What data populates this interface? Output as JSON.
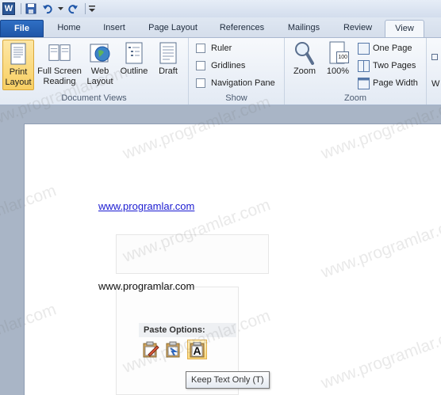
{
  "quick_access": {
    "icons": [
      "word-logo",
      "save-icon",
      "undo-icon",
      "redo-icon",
      "customize-icon"
    ],
    "word_logo_letter": "W"
  },
  "tabs": [
    "File",
    "Home",
    "Insert",
    "Page Layout",
    "References",
    "Mailings",
    "Review",
    "View"
  ],
  "active_tab": "View",
  "ribbon": {
    "document_views": {
      "label": "Document Views",
      "buttons": [
        {
          "line1": "Print",
          "line2": "Layout",
          "selected": true
        },
        {
          "line1": "Full Screen",
          "line2": "Reading",
          "selected": false
        },
        {
          "line1": "Web",
          "line2": "Layout",
          "selected": false
        },
        {
          "line1": "Outline",
          "line2": "",
          "selected": false
        },
        {
          "line1": "Draft",
          "line2": "",
          "selected": false
        }
      ]
    },
    "show": {
      "label": "Show",
      "checkboxes": [
        {
          "label": "Ruler",
          "checked": false
        },
        {
          "label": "Gridlines",
          "checked": false
        },
        {
          "label": "Navigation Pane",
          "checked": false
        }
      ]
    },
    "zoom": {
      "label": "Zoom",
      "zoom_button": "Zoom",
      "percent_button": "100%",
      "percent_icon_text": "100",
      "one_page": "One Page",
      "two_pages": "Two Pages",
      "page_width": "Page Width"
    },
    "next_group_partial": "W"
  },
  "document": {
    "link_text": "www.programlar.com",
    "plain_text": "www.programlar.com",
    "paste_options_label": "Paste Options:",
    "paste_buttons": [
      "keep-source-formatting",
      "merge-formatting",
      "keep-text-only"
    ],
    "keep_text_glyph": "A",
    "tooltip": "Keep Text Only (T)"
  },
  "watermark": "www.programlar.com",
  "colors": {
    "file_tab": "#2a63b5",
    "selected_button": "#f8cf62",
    "link": "#1a1ad1"
  }
}
